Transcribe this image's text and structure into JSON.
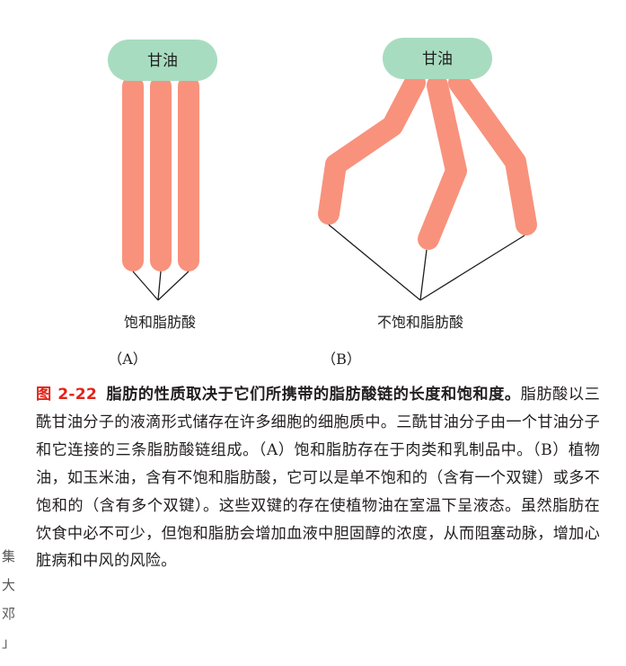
{
  "figure": {
    "panel_a": {
      "glycerol_label": "甘油",
      "chain_label": "饱和脂肪酸",
      "panel_label": "（A）"
    },
    "panel_b": {
      "glycerol_label": "甘油",
      "chain_label": "不饱和脂肪酸",
      "panel_label": "（B）"
    },
    "colors": {
      "glycerol_fill": "#a8dcc0",
      "chain_fill": "#f8927c",
      "caption_accent": "#e2231a"
    }
  },
  "caption": {
    "number": "图 2-22",
    "title": "脂肪的性质取决于它们所携带的脂肪酸链的长度和饱和度。",
    "body": "脂肪酸以三酰甘油分子的液滴形式储存在许多细胞的细胞质中。三酰甘油分子由一个甘油分子和它连接的三条脂肪酸链组成。（A）饱和脂肪存在于肉类和乳制品中。（B）植物油，如玉米油，含有不饱和脂肪酸，它可以是单不饱和的（含有一个双键）或多不饱和的（含有多个双键）。这些双键的存在使植物油在室温下呈液态。虽然脂肪在饮食中必不可少，但饱和脂肪会增加血液中胆固醇的浓度，从而阻塞动脉，增加心脏病和中风的风险。"
  },
  "margin_fragments": [
    "集",
    "大",
    "邓",
    "」"
  ]
}
